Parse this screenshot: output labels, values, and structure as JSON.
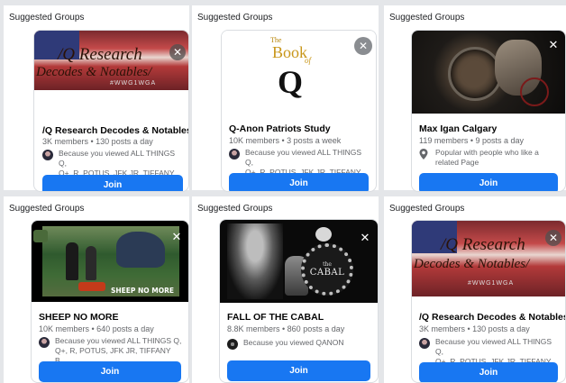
{
  "panels": [
    {
      "title": "Suggested Groups",
      "group": {
        "name": "/Q Research Decodes & Notables/",
        "meta": "3K members • 130 posts a day",
        "reason": "Because you viewed ALL THINGS Q,\nQ+, R, POTUS, JFK JR, TIFFANY B...",
        "cover_text_1": "/Q Research",
        "cover_text_2": "Decodes & Notables/",
        "cover_tag": "#WWG1WGA"
      },
      "join": "Join"
    },
    {
      "title": "Suggested Groups",
      "group": {
        "name": "Q-Anon Patriots Study",
        "meta": "10K members • 3 posts a week",
        "reason": "Because you viewed ALL THINGS Q,\nQ+, R, POTUS, JFK JR, TIFFANY B...",
        "cover_text_1": "The",
        "cover_text_2": "Book",
        "cover_text_3": "of",
        "cover_text_4": "Q"
      },
      "join": "Join"
    },
    {
      "title": "Suggested Groups",
      "group": {
        "name": "Max Igan Calgary",
        "meta": "119 members • 9 posts a day",
        "reason": "Popular with people who like a\nrelated Page"
      },
      "join": "Join"
    },
    {
      "title": "Suggested Groups",
      "group": {
        "name": "SHEEP NO MORE",
        "meta": "10K members • 640 posts a day",
        "reason": "Because you viewed ALL THINGS Q,\nQ+, R, POTUS, JFK JR, TIFFANY B...",
        "cover_text_1": "SHEEP NO MORE"
      },
      "join": "Join"
    },
    {
      "title": "Suggested Groups",
      "group": {
        "name": "FALL OF THE CABAL",
        "meta": "8.8K members • 860 posts a day",
        "reason": "Because you viewed QANON",
        "cover_text_1": "the",
        "cover_text_2": "CABAL"
      },
      "join": "Join"
    },
    {
      "title": "Suggested Groups",
      "group": {
        "name": "/Q Research Decodes & Notables/",
        "meta": "3K members • 130 posts a day",
        "reason": "Because you viewed ALL THINGS Q,\nQ+, R, POTUS, JFK JR, TIFFANY B...",
        "cover_text_1": "/Q Research",
        "cover_text_2": "Decodes & Notables/",
        "cover_tag": "#WWG1WGA"
      },
      "join": "Join"
    }
  ],
  "colors": {
    "join_blue": "#1877f2",
    "meta_grey": "#65676b",
    "panel_bg": "#ffffff"
  },
  "icons": {
    "close": "close-icon",
    "reason_avatar": "group-avatar-icon",
    "location": "location-pin-icon"
  }
}
